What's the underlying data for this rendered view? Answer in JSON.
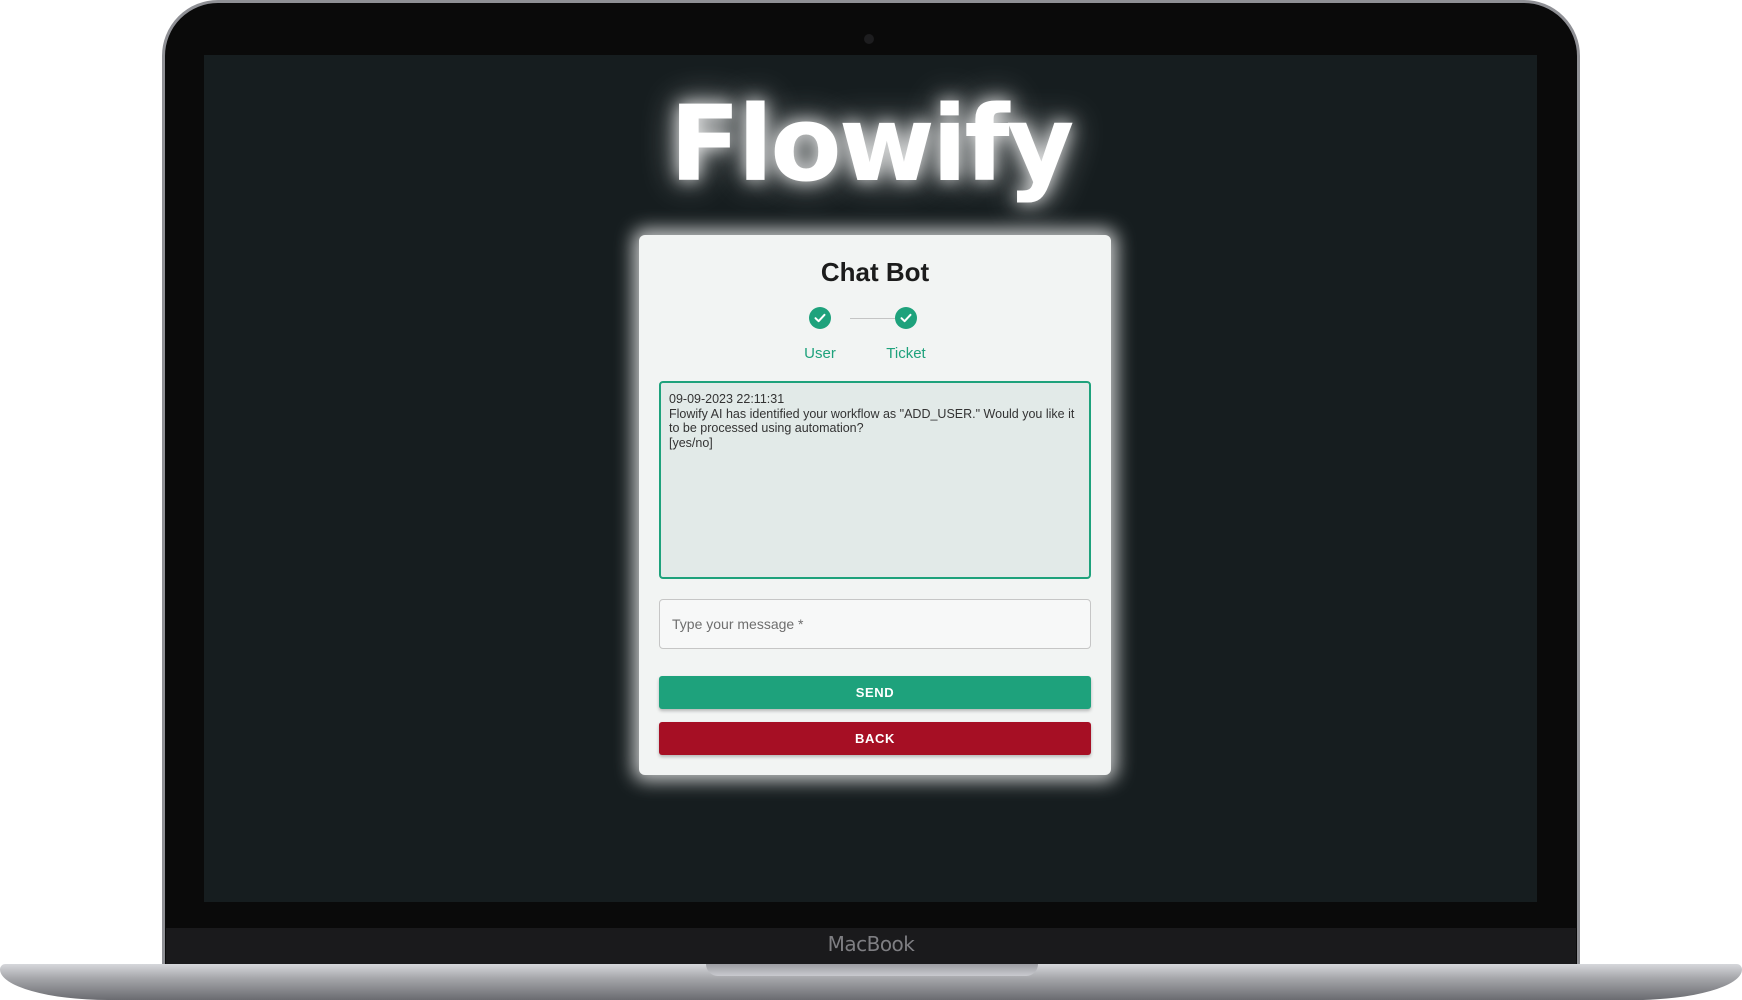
{
  "brand": {
    "logo_text": "Flowify",
    "device_label": "MacBook"
  },
  "chatbot": {
    "title": "Chat Bot",
    "steps": [
      {
        "label": "User",
        "status": "completed",
        "icon": "check-icon"
      },
      {
        "label": "Ticket",
        "status": "completed",
        "icon": "check-icon"
      }
    ],
    "conversation": {
      "timestamp": "09-09-2023 22:11:31",
      "message": "Flowify AI has identified your workflow as \"ADD_USER.\" Would you like it to be processed using automation?",
      "options": "[yes/no]"
    },
    "input": {
      "placeholder": "Type your message *",
      "value": ""
    },
    "buttons": {
      "send_label": "SEND",
      "back_label": "BACK"
    }
  },
  "colors": {
    "accent_green": "#1ea27c",
    "danger_red": "#a60f24",
    "screen_background": "#161d1f",
    "card_background": "#f2f4f3"
  }
}
